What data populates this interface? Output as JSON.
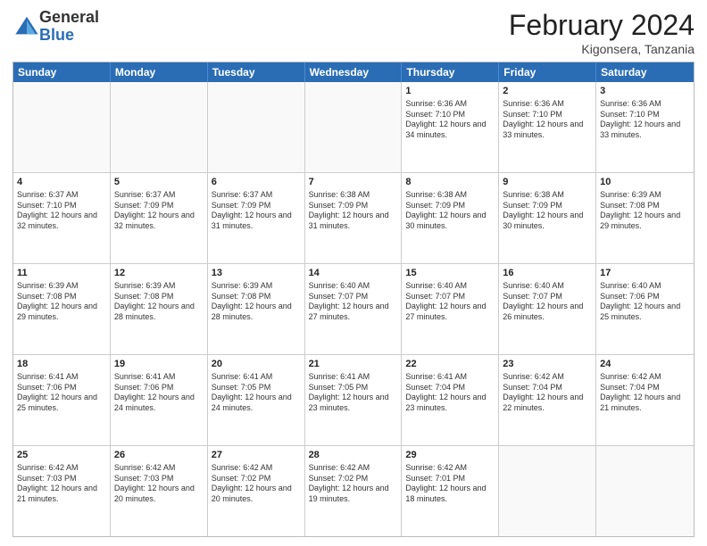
{
  "logo": {
    "general": "General",
    "blue": "Blue"
  },
  "title": {
    "month": "February 2024",
    "location": "Kigonsera, Tanzania"
  },
  "days": [
    "Sunday",
    "Monday",
    "Tuesday",
    "Wednesday",
    "Thursday",
    "Friday",
    "Saturday"
  ],
  "weeks": [
    [
      {
        "day": "",
        "empty": true
      },
      {
        "day": "",
        "empty": true
      },
      {
        "day": "",
        "empty": true
      },
      {
        "day": "",
        "empty": true
      },
      {
        "day": "1",
        "sunrise": "6:36 AM",
        "sunset": "7:10 PM",
        "daylight": "12 hours and 34 minutes."
      },
      {
        "day": "2",
        "sunrise": "6:36 AM",
        "sunset": "7:10 PM",
        "daylight": "12 hours and 33 minutes."
      },
      {
        "day": "3",
        "sunrise": "6:36 AM",
        "sunset": "7:10 PM",
        "daylight": "12 hours and 33 minutes."
      }
    ],
    [
      {
        "day": "4",
        "sunrise": "6:37 AM",
        "sunset": "7:10 PM",
        "daylight": "12 hours and 32 minutes."
      },
      {
        "day": "5",
        "sunrise": "6:37 AM",
        "sunset": "7:09 PM",
        "daylight": "12 hours and 32 minutes."
      },
      {
        "day": "6",
        "sunrise": "6:37 AM",
        "sunset": "7:09 PM",
        "daylight": "12 hours and 31 minutes."
      },
      {
        "day": "7",
        "sunrise": "6:38 AM",
        "sunset": "7:09 PM",
        "daylight": "12 hours and 31 minutes."
      },
      {
        "day": "8",
        "sunrise": "6:38 AM",
        "sunset": "7:09 PM",
        "daylight": "12 hours and 30 minutes."
      },
      {
        "day": "9",
        "sunrise": "6:38 AM",
        "sunset": "7:09 PM",
        "daylight": "12 hours and 30 minutes."
      },
      {
        "day": "10",
        "sunrise": "6:39 AM",
        "sunset": "7:08 PM",
        "daylight": "12 hours and 29 minutes."
      }
    ],
    [
      {
        "day": "11",
        "sunrise": "6:39 AM",
        "sunset": "7:08 PM",
        "daylight": "12 hours and 29 minutes."
      },
      {
        "day": "12",
        "sunrise": "6:39 AM",
        "sunset": "7:08 PM",
        "daylight": "12 hours and 28 minutes."
      },
      {
        "day": "13",
        "sunrise": "6:39 AM",
        "sunset": "7:08 PM",
        "daylight": "12 hours and 28 minutes."
      },
      {
        "day": "14",
        "sunrise": "6:40 AM",
        "sunset": "7:07 PM",
        "daylight": "12 hours and 27 minutes."
      },
      {
        "day": "15",
        "sunrise": "6:40 AM",
        "sunset": "7:07 PM",
        "daylight": "12 hours and 27 minutes."
      },
      {
        "day": "16",
        "sunrise": "6:40 AM",
        "sunset": "7:07 PM",
        "daylight": "12 hours and 26 minutes."
      },
      {
        "day": "17",
        "sunrise": "6:40 AM",
        "sunset": "7:06 PM",
        "daylight": "12 hours and 25 minutes."
      }
    ],
    [
      {
        "day": "18",
        "sunrise": "6:41 AM",
        "sunset": "7:06 PM",
        "daylight": "12 hours and 25 minutes."
      },
      {
        "day": "19",
        "sunrise": "6:41 AM",
        "sunset": "7:06 PM",
        "daylight": "12 hours and 24 minutes."
      },
      {
        "day": "20",
        "sunrise": "6:41 AM",
        "sunset": "7:05 PM",
        "daylight": "12 hours and 24 minutes."
      },
      {
        "day": "21",
        "sunrise": "6:41 AM",
        "sunset": "7:05 PM",
        "daylight": "12 hours and 23 minutes."
      },
      {
        "day": "22",
        "sunrise": "6:41 AM",
        "sunset": "7:04 PM",
        "daylight": "12 hours and 23 minutes."
      },
      {
        "day": "23",
        "sunrise": "6:42 AM",
        "sunset": "7:04 PM",
        "daylight": "12 hours and 22 minutes."
      },
      {
        "day": "24",
        "sunrise": "6:42 AM",
        "sunset": "7:04 PM",
        "daylight": "12 hours and 21 minutes."
      }
    ],
    [
      {
        "day": "25",
        "sunrise": "6:42 AM",
        "sunset": "7:03 PM",
        "daylight": "12 hours and 21 minutes."
      },
      {
        "day": "26",
        "sunrise": "6:42 AM",
        "sunset": "7:03 PM",
        "daylight": "12 hours and 20 minutes."
      },
      {
        "day": "27",
        "sunrise": "6:42 AM",
        "sunset": "7:02 PM",
        "daylight": "12 hours and 20 minutes."
      },
      {
        "day": "28",
        "sunrise": "6:42 AM",
        "sunset": "7:02 PM",
        "daylight": "12 hours and 19 minutes."
      },
      {
        "day": "29",
        "sunrise": "6:42 AM",
        "sunset": "7:01 PM",
        "daylight": "12 hours and 18 minutes."
      },
      {
        "day": "",
        "empty": true
      },
      {
        "day": "",
        "empty": true
      }
    ]
  ]
}
